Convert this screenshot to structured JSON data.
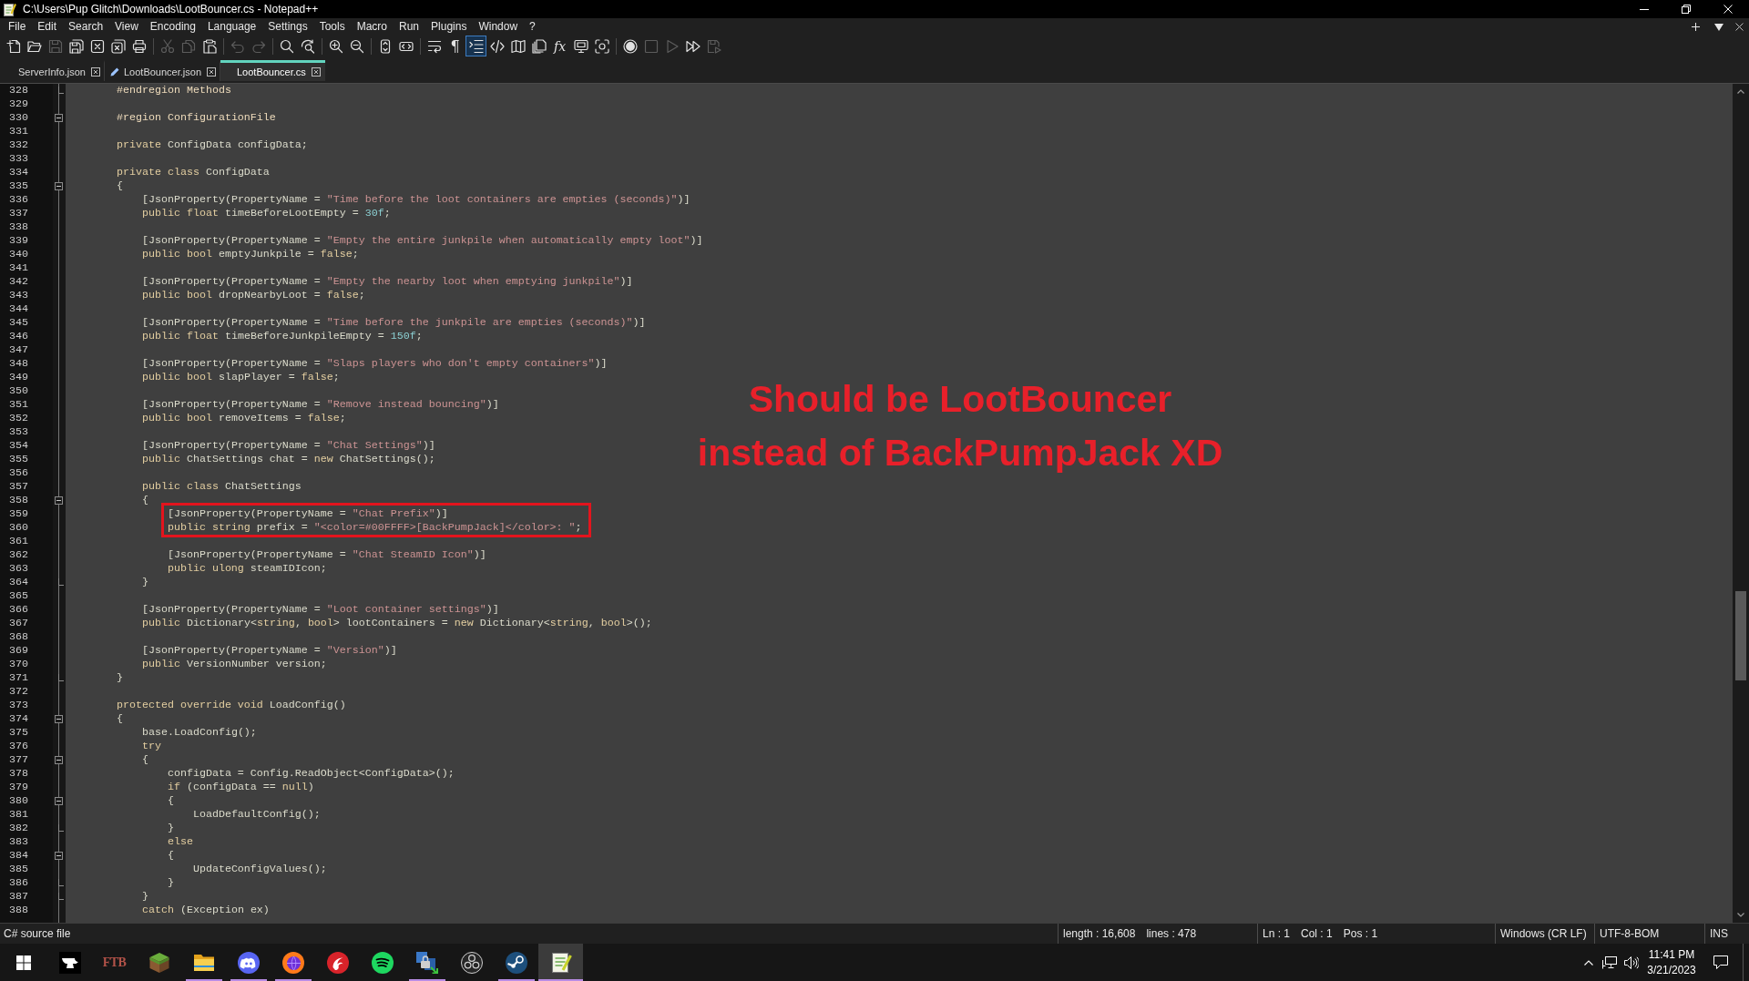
{
  "window": {
    "title": "C:\\Users\\Pup Glitch\\Downloads\\LootBouncer.cs - Notepad++"
  },
  "menu": [
    "File",
    "Edit",
    "Search",
    "View",
    "Encoding",
    "Language",
    "Settings",
    "Tools",
    "Macro",
    "Run",
    "Plugins",
    "Window",
    "?"
  ],
  "toolbar": [
    {
      "kind": "new",
      "disabled": false,
      "on": false
    },
    {
      "kind": "open",
      "disabled": false,
      "on": false
    },
    {
      "kind": "save",
      "disabled": true,
      "on": false
    },
    {
      "kind": "saveall",
      "disabled": false,
      "on": false
    },
    {
      "kind": "close",
      "disabled": false,
      "on": false
    },
    {
      "kind": "closeall",
      "disabled": false,
      "on": false
    },
    {
      "kind": "print",
      "disabled": false,
      "on": false
    },
    {
      "kind": "separator"
    },
    {
      "kind": "cut",
      "disabled": true,
      "on": false
    },
    {
      "kind": "copy",
      "disabled": true,
      "on": false
    },
    {
      "kind": "paste",
      "disabled": false,
      "on": false
    },
    {
      "kind": "separator"
    },
    {
      "kind": "undo",
      "disabled": true,
      "on": false
    },
    {
      "kind": "redo",
      "disabled": true,
      "on": false
    },
    {
      "kind": "separator"
    },
    {
      "kind": "find",
      "disabled": false,
      "on": false
    },
    {
      "kind": "replace",
      "disabled": false,
      "on": false
    },
    {
      "kind": "separator"
    },
    {
      "kind": "zoomin",
      "disabled": false,
      "on": false
    },
    {
      "kind": "zoomout",
      "disabled": false,
      "on": false
    },
    {
      "kind": "separator"
    },
    {
      "kind": "syncv",
      "disabled": false,
      "on": false
    },
    {
      "kind": "synch",
      "disabled": false,
      "on": false
    },
    {
      "kind": "separator"
    },
    {
      "kind": "wrap",
      "disabled": false,
      "on": false
    },
    {
      "kind": "pilcrow",
      "label": "¶",
      "disabled": false,
      "on": false
    },
    {
      "kind": "indentguide",
      "disabled": false,
      "on": true
    },
    {
      "kind": "tag",
      "disabled": false,
      "on": false
    },
    {
      "kind": "docmap",
      "disabled": false,
      "on": false
    },
    {
      "kind": "doclist",
      "disabled": false,
      "on": false
    },
    {
      "kind": "functions",
      "label": "fx",
      "disabled": false,
      "on": false
    },
    {
      "kind": "workspace",
      "disabled": false,
      "on": false
    },
    {
      "kind": "monitor",
      "disabled": false,
      "on": false
    },
    {
      "kind": "separator"
    },
    {
      "kind": "record",
      "disabled": false,
      "on": false
    },
    {
      "kind": "stop",
      "disabled": true,
      "on": false
    },
    {
      "kind": "play",
      "disabled": true,
      "on": false
    },
    {
      "kind": "playmulti",
      "disabled": false,
      "on": false
    },
    {
      "kind": "savemacro",
      "disabled": true,
      "on": false
    }
  ],
  "tabs": [
    {
      "label": "ServerInfo.json",
      "selected": false,
      "modified": false
    },
    {
      "label": "LootBouncer.json",
      "selected": false,
      "modified": true
    },
    {
      "label": "LootBouncer.cs",
      "selected": true,
      "modified": false
    }
  ],
  "editor": {
    "lines": [
      {
        "number": "328",
        "fold": {
          "kind": "end"
        },
        "highlighted": false,
        "tokens": [
          {
            "kind": "preprocessor",
            "text": "        #endregion Methods"
          }
        ]
      },
      {
        "number": "329",
        "highlighted": false
      },
      {
        "number": "330",
        "fold": {
          "kind": "start",
          "expanded": true
        },
        "highlighted": false,
        "tokens": [
          {
            "kind": "preprocessor",
            "text": "        #region ConfigurationFile"
          }
        ]
      },
      {
        "number": "331",
        "highlighted": false
      },
      {
        "number": "332",
        "highlighted": false,
        "tokens": [
          {
            "kind": "keyword",
            "text": "        private"
          },
          {
            "kind": "plain",
            "text": " ConfigData configData;"
          }
        ]
      },
      {
        "number": "333",
        "highlighted": false
      },
      {
        "number": "334",
        "highlighted": false,
        "tokens": [
          {
            "kind": "keyword",
            "text": "        private class"
          },
          {
            "kind": "plain",
            "text": " ConfigData"
          }
        ]
      },
      {
        "number": "335",
        "fold": {
          "kind": "start",
          "expanded": true
        },
        "highlighted": false,
        "tokens": [
          {
            "kind": "plain",
            "text": "        {"
          }
        ]
      },
      {
        "number": "336",
        "highlighted": false,
        "tokens": [
          {
            "kind": "plain",
            "text": "            [JsonProperty(PropertyName = "
          },
          {
            "kind": "string",
            "text": "\"Time before the loot containers are empties (seconds)\""
          },
          {
            "kind": "plain",
            "text": ")]"
          }
        ]
      },
      {
        "number": "337",
        "highlighted": false,
        "tokens": [
          {
            "kind": "keyword",
            "text": "            public float"
          },
          {
            "kind": "plain",
            "text": " timeBeforeLootEmpty = "
          },
          {
            "kind": "number",
            "text": "30f"
          },
          {
            "kind": "plain",
            "text": ";"
          }
        ]
      },
      {
        "number": "338",
        "highlighted": false
      },
      {
        "number": "339",
        "highlighted": false,
        "tokens": [
          {
            "kind": "plain",
            "text": "            [JsonProperty(PropertyName = "
          },
          {
            "kind": "string",
            "text": "\"Empty the entire junkpile when automatically empty loot\""
          },
          {
            "kind": "plain",
            "text": ")]"
          }
        ]
      },
      {
        "number": "340",
        "highlighted": false,
        "tokens": [
          {
            "kind": "keyword",
            "text": "            public bool"
          },
          {
            "kind": "plain",
            "text": " emptyJunkpile = "
          },
          {
            "kind": "keyword",
            "text": "false"
          },
          {
            "kind": "plain",
            "text": ";"
          }
        ]
      },
      {
        "number": "341",
        "highlighted": false
      },
      {
        "number": "342",
        "highlighted": false,
        "tokens": [
          {
            "kind": "plain",
            "text": "            [JsonProperty(PropertyName = "
          },
          {
            "kind": "string",
            "text": "\"Empty the nearby loot when emptying junkpile\""
          },
          {
            "kind": "plain",
            "text": ")]"
          }
        ]
      },
      {
        "number": "343",
        "highlighted": false,
        "tokens": [
          {
            "kind": "keyword",
            "text": "            public bool"
          },
          {
            "kind": "plain",
            "text": " dropNearbyLoot = "
          },
          {
            "kind": "keyword",
            "text": "false"
          },
          {
            "kind": "plain",
            "text": ";"
          }
        ]
      },
      {
        "number": "344",
        "highlighted": false
      },
      {
        "number": "345",
        "highlighted": false,
        "tokens": [
          {
            "kind": "plain",
            "text": "            [JsonProperty(PropertyName = "
          },
          {
            "kind": "string",
            "text": "\"Time before the junkpile are empties (seconds)\""
          },
          {
            "kind": "plain",
            "text": ")]"
          }
        ]
      },
      {
        "number": "346",
        "highlighted": false,
        "tokens": [
          {
            "kind": "keyword",
            "text": "            public float"
          },
          {
            "kind": "plain",
            "text": " timeBeforeJunkpileEmpty = "
          },
          {
            "kind": "number",
            "text": "150f"
          },
          {
            "kind": "plain",
            "text": ";"
          }
        ]
      },
      {
        "number": "347",
        "highlighted": false
      },
      {
        "number": "348",
        "highlighted": false,
        "tokens": [
          {
            "kind": "plain",
            "text": "            [JsonProperty(PropertyName = "
          },
          {
            "kind": "string",
            "text": "\"Slaps players who don't empty containers\""
          },
          {
            "kind": "plain",
            "text": ")]"
          }
        ]
      },
      {
        "number": "349",
        "highlighted": false,
        "tokens": [
          {
            "kind": "keyword",
            "text": "            public bool"
          },
          {
            "kind": "plain",
            "text": " slapPlayer = "
          },
          {
            "kind": "keyword",
            "text": "false"
          },
          {
            "kind": "plain",
            "text": ";"
          }
        ]
      },
      {
        "number": "350",
        "highlighted": false
      },
      {
        "number": "351",
        "highlighted": false,
        "tokens": [
          {
            "kind": "plain",
            "text": "            [JsonProperty(PropertyName = "
          },
          {
            "kind": "string",
            "text": "\"Remove instead bouncing\""
          },
          {
            "kind": "plain",
            "text": ")]"
          }
        ]
      },
      {
        "number": "352",
        "highlighted": false,
        "tokens": [
          {
            "kind": "keyword",
            "text": "            public bool"
          },
          {
            "kind": "plain",
            "text": " removeItems = "
          },
          {
            "kind": "keyword",
            "text": "false"
          },
          {
            "kind": "plain",
            "text": ";"
          }
        ]
      },
      {
        "number": "353",
        "highlighted": false
      },
      {
        "number": "354",
        "highlighted": false,
        "tokens": [
          {
            "kind": "plain",
            "text": "            [JsonProperty(PropertyName = "
          },
          {
            "kind": "string",
            "text": "\"Chat Settings\""
          },
          {
            "kind": "plain",
            "text": ")]"
          }
        ]
      },
      {
        "number": "355",
        "highlighted": false,
        "tokens": [
          {
            "kind": "keyword",
            "text": "            public"
          },
          {
            "kind": "plain",
            "text": " ChatSettings chat = "
          },
          {
            "kind": "keyword",
            "text": "new"
          },
          {
            "kind": "plain",
            "text": " ChatSettings();"
          }
        ]
      },
      {
        "number": "356",
        "highlighted": false
      },
      {
        "number": "357",
        "highlighted": false,
        "tokens": [
          {
            "kind": "keyword",
            "text": "            public class"
          },
          {
            "kind": "plain",
            "text": " ChatSettings"
          }
        ]
      },
      {
        "number": "358",
        "fold": {
          "kind": "start",
          "expanded": true
        },
        "highlighted": false,
        "tokens": [
          {
            "kind": "plain",
            "text": "            {"
          }
        ]
      },
      {
        "number": "359",
        "highlighted": true,
        "tokens": [
          {
            "kind": "plain",
            "text": "                [JsonProperty(PropertyName = "
          },
          {
            "kind": "string",
            "text": "\"Chat Prefix\""
          },
          {
            "kind": "plain",
            "text": ")]"
          }
        ]
      },
      {
        "number": "360",
        "highlighted": true,
        "tokens": [
          {
            "kind": "keyword",
            "text": "                public string"
          },
          {
            "kind": "plain",
            "text": " prefix = "
          },
          {
            "kind": "string",
            "text": "\"<color=#00FFFF>[BackPumpJack]</color>: \""
          },
          {
            "kind": "plain",
            "text": ";"
          }
        ]
      },
      {
        "number": "361",
        "highlighted": false
      },
      {
        "number": "362",
        "highlighted": false,
        "tokens": [
          {
            "kind": "plain",
            "text": "                [JsonProperty(PropertyName = "
          },
          {
            "kind": "string",
            "text": "\"Chat SteamID Icon\""
          },
          {
            "kind": "plain",
            "text": ")]"
          }
        ]
      },
      {
        "number": "363",
        "highlighted": false,
        "tokens": [
          {
            "kind": "keyword",
            "text": "                public ulong"
          },
          {
            "kind": "plain",
            "text": " steamIDIcon;"
          }
        ]
      },
      {
        "number": "364",
        "fold": {
          "kind": "end"
        },
        "highlighted": false,
        "tokens": [
          {
            "kind": "plain",
            "text": "            }"
          }
        ]
      },
      {
        "number": "365",
        "highlighted": false
      },
      {
        "number": "366",
        "highlighted": false,
        "tokens": [
          {
            "kind": "plain",
            "text": "            [JsonProperty(PropertyName = "
          },
          {
            "kind": "string",
            "text": "\"Loot container settings\""
          },
          {
            "kind": "plain",
            "text": ")]"
          }
        ]
      },
      {
        "number": "367",
        "highlighted": false,
        "tokens": [
          {
            "kind": "keyword",
            "text": "            public"
          },
          {
            "kind": "plain",
            "text": " Dictionary<"
          },
          {
            "kind": "keyword",
            "text": "string"
          },
          {
            "kind": "plain",
            "text": ", "
          },
          {
            "kind": "keyword",
            "text": "bool"
          },
          {
            "kind": "plain",
            "text": "> lootContainers = "
          },
          {
            "kind": "keyword",
            "text": "new"
          },
          {
            "kind": "plain",
            "text": " Dictionary<"
          },
          {
            "kind": "keyword",
            "text": "string"
          },
          {
            "kind": "plain",
            "text": ", "
          },
          {
            "kind": "keyword",
            "text": "bool"
          },
          {
            "kind": "plain",
            "text": ">();"
          }
        ]
      },
      {
        "number": "368",
        "highlighted": false
      },
      {
        "number": "369",
        "highlighted": false,
        "tokens": [
          {
            "kind": "plain",
            "text": "            [JsonProperty(PropertyName = "
          },
          {
            "kind": "string",
            "text": "\"Version\""
          },
          {
            "kind": "plain",
            "text": ")]"
          }
        ]
      },
      {
        "number": "370",
        "highlighted": false,
        "tokens": [
          {
            "kind": "keyword",
            "text": "            public"
          },
          {
            "kind": "plain",
            "text": " VersionNumber version;"
          }
        ]
      },
      {
        "number": "371",
        "fold": {
          "kind": "end"
        },
        "highlighted": false,
        "tokens": [
          {
            "kind": "plain",
            "text": "        }"
          }
        ]
      },
      {
        "number": "372",
        "highlighted": false
      },
      {
        "number": "373",
        "highlighted": false,
        "tokens": [
          {
            "kind": "keyword",
            "text": "        protected override void"
          },
          {
            "kind": "plain",
            "text": " LoadConfig()"
          }
        ]
      },
      {
        "number": "374",
        "fold": {
          "kind": "start",
          "expanded": true
        },
        "highlighted": false,
        "tokens": [
          {
            "kind": "plain",
            "text": "        {"
          }
        ]
      },
      {
        "number": "375",
        "highlighted": false,
        "tokens": [
          {
            "kind": "plain",
            "text": "            base.LoadConfig();"
          }
        ]
      },
      {
        "number": "376",
        "highlighted": false,
        "tokens": [
          {
            "kind": "keyword",
            "text": "            try"
          }
        ]
      },
      {
        "number": "377",
        "fold": {
          "kind": "start",
          "expanded": true
        },
        "highlighted": false,
        "tokens": [
          {
            "kind": "plain",
            "text": "            {"
          }
        ]
      },
      {
        "number": "378",
        "highlighted": false,
        "tokens": [
          {
            "kind": "plain",
            "text": "                configData = Config.ReadObject<ConfigData>();"
          }
        ]
      },
      {
        "number": "379",
        "highlighted": false,
        "tokens": [
          {
            "kind": "keyword",
            "text": "                if"
          },
          {
            "kind": "plain",
            "text": " (configData == "
          },
          {
            "kind": "keyword",
            "text": "null"
          },
          {
            "kind": "plain",
            "text": ")"
          }
        ]
      },
      {
        "number": "380",
        "fold": {
          "kind": "start",
          "expanded": true
        },
        "highlighted": false,
        "tokens": [
          {
            "kind": "plain",
            "text": "                {"
          }
        ]
      },
      {
        "number": "381",
        "highlighted": false,
        "tokens": [
          {
            "kind": "plain",
            "text": "                    LoadDefaultConfig();"
          }
        ]
      },
      {
        "number": "382",
        "fold": {
          "kind": "end"
        },
        "highlighted": false,
        "tokens": [
          {
            "kind": "plain",
            "text": "                }"
          }
        ]
      },
      {
        "number": "383",
        "highlighted": false,
        "tokens": [
          {
            "kind": "keyword",
            "text": "                else"
          }
        ]
      },
      {
        "number": "384",
        "fold": {
          "kind": "start",
          "expanded": true
        },
        "highlighted": false,
        "tokens": [
          {
            "kind": "plain",
            "text": "                {"
          }
        ]
      },
      {
        "number": "385",
        "highlighted": false,
        "tokens": [
          {
            "kind": "plain",
            "text": "                    UpdateConfigValues();"
          }
        ]
      },
      {
        "number": "386",
        "fold": {
          "kind": "end"
        },
        "highlighted": false,
        "tokens": [
          {
            "kind": "plain",
            "text": "                }"
          }
        ]
      },
      {
        "number": "387",
        "fold": {
          "kind": "end"
        },
        "highlighted": false,
        "tokens": [
          {
            "kind": "plain",
            "text": "            }"
          }
        ]
      },
      {
        "number": "388",
        "highlighted": false,
        "tokens": [
          {
            "kind": "keyword",
            "text": "            catch"
          },
          {
            "kind": "plain",
            "text": " (Exception ex)"
          }
        ]
      }
    ],
    "annotation": {
      "lines": [
        "Should be LootBouncer",
        "instead of BackPumpJack XD"
      ]
    }
  },
  "status_bar": {
    "sections": [
      [
        "C# source file"
      ],
      [
        "length : 16,608",
        "lines : 478"
      ],
      [
        "Ln : 1",
        "Col : 1",
        "Pos : 1"
      ],
      [
        "Windows (CR LF)"
      ],
      [
        "UTF-8-BOM"
      ],
      [
        "INS"
      ]
    ]
  },
  "taskbar": {
    "apps": [
      {
        "kind": "anvil",
        "running": false,
        "active": false
      },
      {
        "kind": "ftb",
        "label": "FTB",
        "running": false,
        "active": false
      },
      {
        "kind": "block",
        "running": false,
        "active": false
      },
      {
        "kind": "folder",
        "running": true,
        "active": false
      },
      {
        "kind": "controller",
        "running": true,
        "active": false
      },
      {
        "kind": "globe",
        "running": true,
        "active": false
      },
      {
        "kind": "swirl",
        "running": false,
        "active": false
      },
      {
        "kind": "waves",
        "running": false,
        "active": false
      },
      {
        "kind": "lock",
        "running": true,
        "active": false
      },
      {
        "kind": "aperture",
        "running": false,
        "active": false
      },
      {
        "kind": "piston",
        "running": true,
        "active": false
      },
      {
        "kind": "notepad",
        "running": true,
        "active": true
      }
    ],
    "clock": {
      "time": "11:41 PM",
      "date": "3/21/2023"
    }
  }
}
